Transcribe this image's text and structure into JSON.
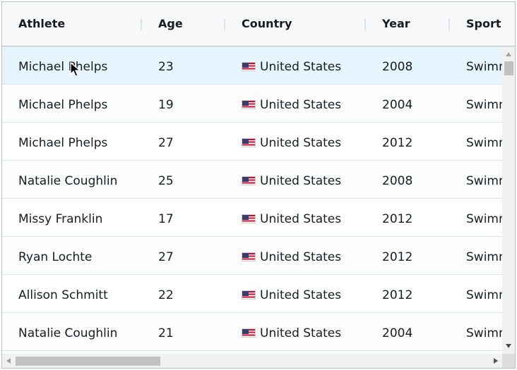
{
  "columns": [
    "Athlete",
    "Age",
    "Country",
    "Year",
    "Sport"
  ],
  "rows": [
    {
      "athlete": "Michael Phelps",
      "age": "23",
      "country": "United States",
      "year": "2008",
      "sport": "Swimming"
    },
    {
      "athlete": "Michael Phelps",
      "age": "19",
      "country": "United States",
      "year": "2004",
      "sport": "Swimming"
    },
    {
      "athlete": "Michael Phelps",
      "age": "27",
      "country": "United States",
      "year": "2012",
      "sport": "Swimming"
    },
    {
      "athlete": "Natalie Coughlin",
      "age": "25",
      "country": "United States",
      "year": "2008",
      "sport": "Swimming"
    },
    {
      "athlete": "Missy Franklin",
      "age": "17",
      "country": "United States",
      "year": "2012",
      "sport": "Swimming"
    },
    {
      "athlete": "Ryan Lochte",
      "age": "27",
      "country": "United States",
      "year": "2012",
      "sport": "Swimming"
    },
    {
      "athlete": "Allison Schmitt",
      "age": "22",
      "country": "United States",
      "year": "2012",
      "sport": "Swimming"
    },
    {
      "athlete": "Natalie Coughlin",
      "age": "21",
      "country": "United States",
      "year": "2004",
      "sport": "Swimming"
    }
  ],
  "hovered_row": 0,
  "icons": {
    "country_flag": "us-flag-icon",
    "cursor": "mouse-pointer-icon"
  },
  "colors": {
    "header_bg": "#f8f8f8",
    "hover_row": "#e6f4fd",
    "border": "#babfc7",
    "row_divider": "#dde2eb",
    "text": "#181d1f"
  }
}
